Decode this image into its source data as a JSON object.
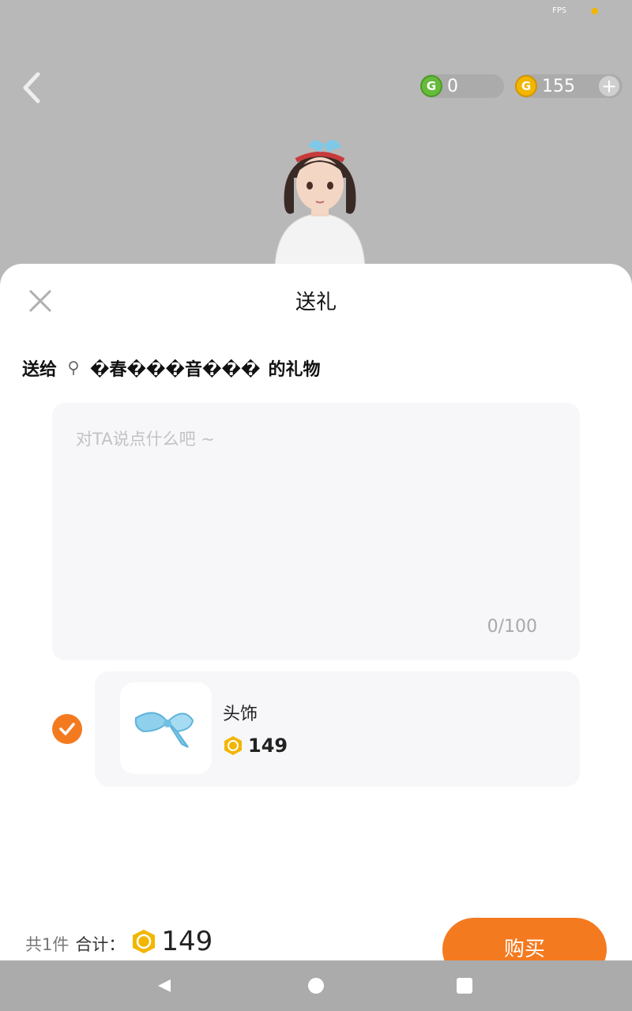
{
  "status": {
    "fps_label": "FPS"
  },
  "header": {
    "currency_g": "0",
    "currency_coin": "155"
  },
  "dialog": {
    "title": "送礼",
    "send_to_prefix": "送给",
    "recipient_name": "�春���音���",
    "send_to_suffix": "的礼物",
    "message_placeholder": "对TA说点什么吧 ~",
    "message_counter": "0/100"
  },
  "item": {
    "name": "头饰",
    "price": "149",
    "selected": true
  },
  "footer": {
    "count_label": "共1件",
    "total_label": "合计：",
    "total_amount": "149",
    "buy_label": "购买"
  },
  "colors": {
    "accent": "#f47a20",
    "coin": "#f2b600",
    "g_coin": "#66bb3b"
  }
}
